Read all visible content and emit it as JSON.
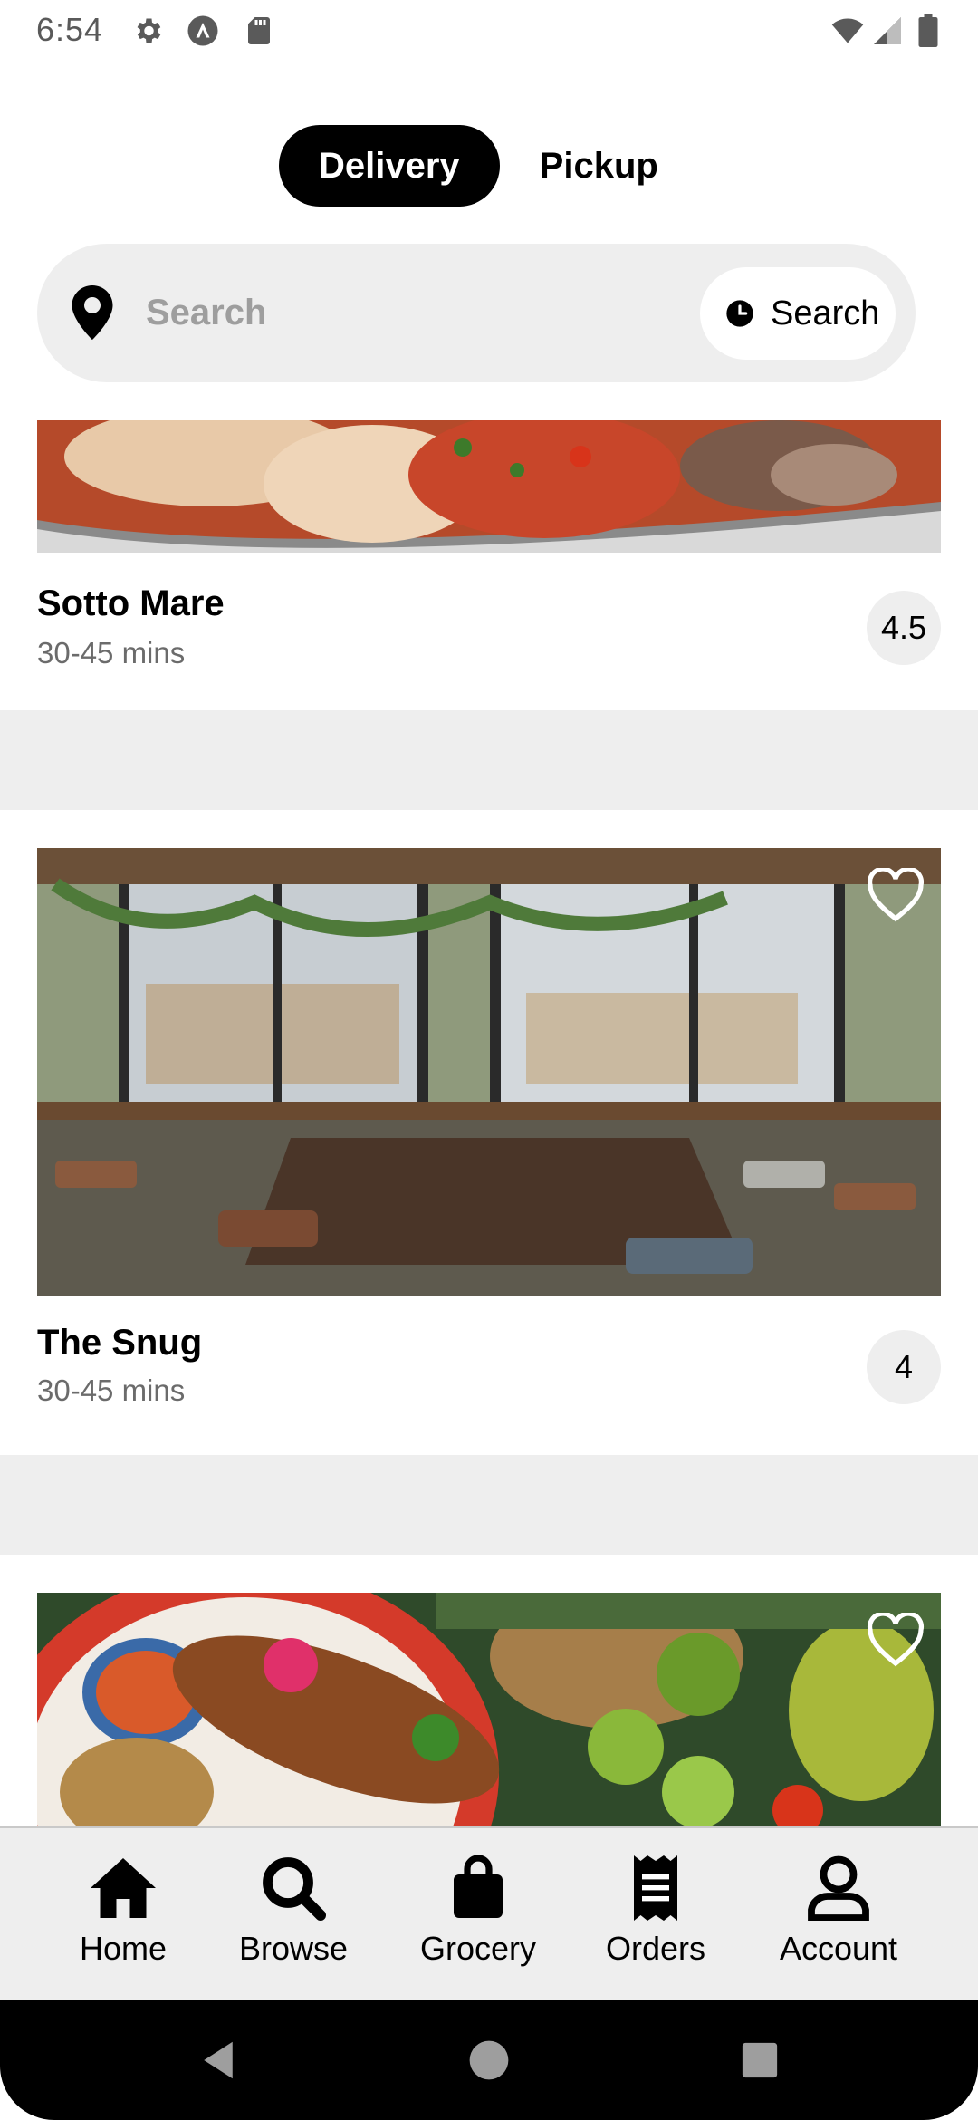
{
  "status_bar": {
    "time": "6:54",
    "icons": [
      "gear-icon",
      "app-logo-icon",
      "sd-card-icon",
      "wifi-icon",
      "signal-icon",
      "battery-icon"
    ]
  },
  "mode_toggle": {
    "active_label": "Delivery",
    "inactive_label": "Pickup"
  },
  "search": {
    "placeholder": "Search",
    "time_button_label": "Search"
  },
  "restaurants": [
    {
      "name": "Sotto Mare",
      "eta": "30-45 mins",
      "rating": "4.5"
    },
    {
      "name": "The Snug",
      "eta": "30-45 mins",
      "rating": "4"
    },
    {
      "name": "",
      "eta": "",
      "rating": ""
    }
  ],
  "bottom_nav": {
    "items": [
      {
        "label": "Home",
        "icon": "home-icon"
      },
      {
        "label": "Browse",
        "icon": "search-icon"
      },
      {
        "label": "Grocery",
        "icon": "shopping-bag-icon"
      },
      {
        "label": "Orders",
        "icon": "receipt-icon"
      },
      {
        "label": "Account",
        "icon": "person-icon"
      }
    ]
  },
  "system_nav": {
    "icons": [
      "back-icon",
      "home-circle-icon",
      "recents-icon"
    ]
  },
  "colors": {
    "accent": "#000000",
    "surface": "#eeeeee",
    "muted_text": "#6b6b6b"
  }
}
